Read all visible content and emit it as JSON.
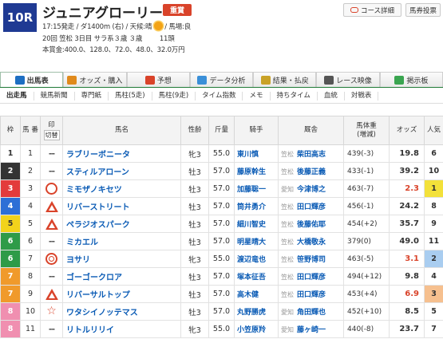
{
  "race": {
    "number": "10R",
    "name": "ジュニアグローリー",
    "grade": "重賞",
    "meta1_a": "17:15発走 / ダ1400m (右) / 天候:晴",
    "meta1_b": "/ 馬場:良",
    "meta2": "20回 笠松 3日目 サラ系３歳 ３歳 　　 11頭",
    "meta3": "本賞金:400.0、128.0、72.0、48.0、32.0万円"
  },
  "buttons": {
    "course": "コース詳細",
    "ticket": "馬券投票"
  },
  "tabs": [
    {
      "label": "出馬表",
      "color": "#1d6fc2"
    },
    {
      "label": "オッズ・購入",
      "color": "#e08a1c"
    },
    {
      "label": "予想",
      "color": "#d9432a"
    },
    {
      "label": "データ分析",
      "color": "#3a8fd8"
    },
    {
      "label": "結果・払戻",
      "color": "#c9a227"
    },
    {
      "label": "レース映像",
      "color": "#555555"
    },
    {
      "label": "掲示板",
      "color": "#3aa550"
    }
  ],
  "subtabs": [
    "出走馬",
    "競馬新聞",
    "専門紙",
    "馬柱(5走)",
    "馬柱(9走)",
    "タイム指数",
    "メモ",
    "持ちタイム",
    "血統",
    "対戦表"
  ],
  "columns": {
    "waku": "枠",
    "umaban": "馬\n番",
    "mark": "印",
    "mark_sub": "切​替",
    "name": "馬名",
    "sex": "性齢",
    "weight": "斤量",
    "jockey": "騎手",
    "stable": "厩舎",
    "hw": "馬体重",
    "hw_sub": "(増減)",
    "odds": "オッズ",
    "pop": "人気"
  },
  "horses": [
    {
      "waku": "1",
      "umaban": "1",
      "mark": "dash",
      "name": "ラブリーボニータ",
      "sex": "牝3",
      "weight": "55.0",
      "jockey": "東川慎",
      "loc": "笠松",
      "trainer": "柴田高志",
      "hw": "439(-3)",
      "odds": "19.8",
      "pop": "6"
    },
    {
      "waku": "2",
      "umaban": "2",
      "mark": "dash",
      "name": "スティルアローン",
      "sex": "牡3",
      "weight": "57.0",
      "jockey": "藤原幹生",
      "loc": "笠松",
      "trainer": "後藤正義",
      "hw": "433(-1)",
      "odds": "39.2",
      "pop": "10"
    },
    {
      "waku": "3",
      "umaban": "3",
      "mark": "circle",
      "name": "ミモザノキセツ",
      "sex": "牡3",
      "weight": "57.0",
      "jockey": "加藤聡一",
      "loc": "愛知",
      "trainer": "今津博之",
      "hw": "463(-7)",
      "odds": "2.3",
      "pop": "1"
    },
    {
      "waku": "4",
      "umaban": "4",
      "mark": "triangle",
      "name": "リバーストリート",
      "sex": "牡3",
      "weight": "57.0",
      "jockey": "筒井勇介",
      "loc": "笠松",
      "trainer": "田口輝彦",
      "hw": "456(-1)",
      "odds": "24.2",
      "pop": "8"
    },
    {
      "waku": "5",
      "umaban": "5",
      "mark": "triangle",
      "name": "ペラジオスパーク",
      "sex": "牡3",
      "weight": "57.0",
      "jockey": "細川智史",
      "loc": "笠松",
      "trainer": "後藤佑耶",
      "hw": "454(+2)",
      "odds": "35.7",
      "pop": "9"
    },
    {
      "waku": "6",
      "umaban": "6",
      "mark": "dash",
      "name": "ミカエル",
      "sex": "牡3",
      "weight": "57.0",
      "jockey": "明星晴大",
      "loc": "笠松",
      "trainer": "大橋敬永",
      "hw": "379(0)",
      "odds": "49.0",
      "pop": "11"
    },
    {
      "waku": "6",
      "umaban": "7",
      "mark": "double",
      "name": "ヨサリ",
      "sex": "牝3",
      "weight": "55.0",
      "jockey": "渡辺竜也",
      "loc": "笠松",
      "trainer": "笹野博司",
      "hw": "463(-5)",
      "odds": "3.1",
      "pop": "2"
    },
    {
      "waku": "7",
      "umaban": "8",
      "mark": "dash",
      "name": "ゴーゴークロア",
      "sex": "牡3",
      "weight": "57.0",
      "jockey": "塚本征吾",
      "loc": "笠松",
      "trainer": "田口輝彦",
      "hw": "494(+12)",
      "odds": "9.8",
      "pop": "4"
    },
    {
      "waku": "7",
      "umaban": "9",
      "mark": "triangle",
      "name": "リバーサルトップ",
      "sex": "牡3",
      "weight": "57.0",
      "jockey": "高木健",
      "loc": "笠松",
      "trainer": "田口輝彦",
      "hw": "453(+4)",
      "odds": "6.9",
      "pop": "3"
    },
    {
      "waku": "8",
      "umaban": "10",
      "mark": "star",
      "name": "ワタシイノッテマス",
      "sex": "牡3",
      "weight": "57.0",
      "jockey": "丸野勝虎",
      "loc": "愛知",
      "trainer": "角田輝也",
      "hw": "452(+10)",
      "odds": "8.5",
      "pop": "5"
    },
    {
      "waku": "8",
      "umaban": "11",
      "mark": "dash",
      "name": "リトルリリイ",
      "sex": "牝3",
      "weight": "55.0",
      "jockey": "小笠原羚",
      "loc": "愛知",
      "trainer": "藤ヶ崎一",
      "hw": "440(-8)",
      "odds": "23.7",
      "pop": "7"
    }
  ],
  "waku_colors": {
    "1": [
      "#ffffff",
      "#333333"
    ],
    "2": [
      "#333333",
      "#ffffff"
    ],
    "3": [
      "#e33b3b",
      "#ffffff"
    ],
    "4": [
      "#2d6fd6",
      "#ffffff"
    ],
    "5": [
      "#f2d31b",
      "#333333"
    ],
    "6": [
      "#2e9b48",
      "#ffffff"
    ],
    "7": [
      "#f09a2b",
      "#ffffff"
    ],
    "8": [
      "#f08fb0",
      "#ffffff"
    ]
  },
  "fav_colors": {
    "1": "#f3e13a",
    "2": "#a9cdf0",
    "3": "#f6c08f"
  }
}
